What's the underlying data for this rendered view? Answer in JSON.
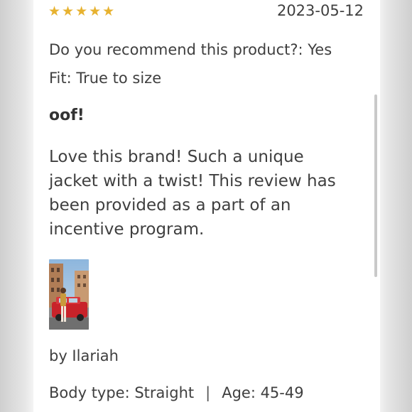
{
  "review": {
    "rating_stars": "★★★★★",
    "date": "2023-05-12",
    "recommend": "Do you recommend this product?: Yes",
    "fit": "Fit: True to size",
    "title": "oof!",
    "body": "Love this brand! Such a unique jacket with a twist! This review has been provided as a part of an incentive program.",
    "author": "by Ilariah",
    "body_type": "Body type: Straight",
    "separator": "|",
    "age": "Age: 45-49"
  },
  "colors": {
    "star": "#e7b230",
    "text": "#3f3f3f",
    "card_background": "#ffffff"
  },
  "icons": {
    "rating": "star-icon"
  }
}
